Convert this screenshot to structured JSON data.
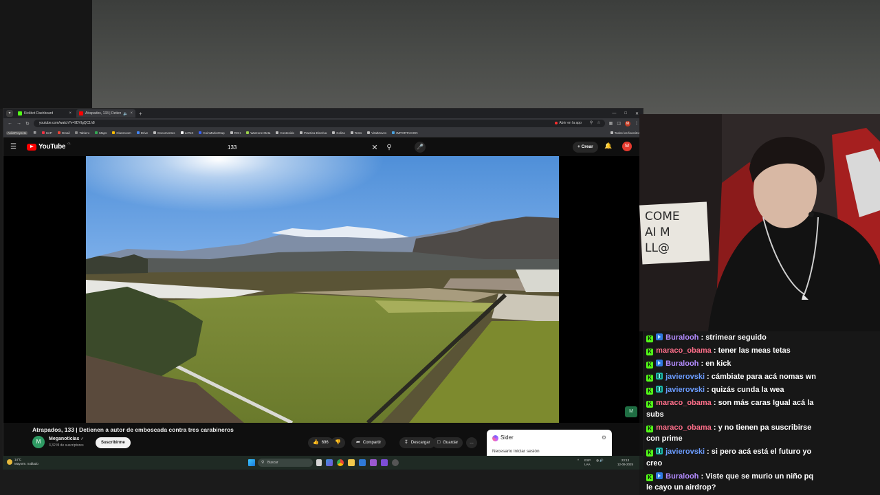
{
  "browser": {
    "tabs": [
      {
        "title": "Kickbot Dashboard",
        "active": false
      },
      {
        "title": "Atrapados, 133 | Detienen a",
        "active": true
      }
    ],
    "url": "youtube.com/watch?v=9DVlgQC1h8",
    "open_in_app": "Abrir en la app",
    "profile_initial": "M",
    "bookmarks": [
      "AvilaProyecto",
      "SAP",
      "Gmail",
      "Tablero",
      "Maps",
      "Classroom",
      "Drive",
      "Documentos",
      "LoToX",
      "CoinMarketCap",
      "RCH",
      "Warzone Meta",
      "Contenido",
      "Practica Electiva",
      "Coliza",
      "Tests",
      "VitalMoves",
      "IMPORTACION"
    ],
    "all_bookmarks": "Todos los favoritos"
  },
  "youtube": {
    "logo_text": "YouTube",
    "country": "CL",
    "search_query": "133",
    "create_label": "Crear",
    "avatar_initial": "M",
    "video_title": "Atrapados, 133 | Detienen a autor de emboscada contra tres carabineros",
    "channel_name": "Meganoticias",
    "channel_subs": "3,32 M de suscriptores",
    "subscribe_label": "Suscribirme",
    "likes": "696",
    "share_label": "Compartir",
    "download_label": "Descargar",
    "save_label": "Guardar",
    "more_label": "…"
  },
  "sider": {
    "title": "Sider",
    "message": "Necesario iniciar sesión"
  },
  "taskbar": {
    "temperature": "14°C",
    "weather_text": "Mayorm. nublado",
    "search_placeholder": "Buscar",
    "lang_1": "ESP",
    "lang_2": "LAA",
    "time": "23:13",
    "date": "12-09-2025"
  },
  "chat": {
    "messages": [
      {
        "user": "Buralooh",
        "text": "strimear seguido",
        "color": "#b38bff",
        "badges": [
          "kick",
          "blue"
        ]
      },
      {
        "user": "maraco_obama",
        "text": "tener las meas tetas",
        "color": "#ff6f8a",
        "badges": [
          "kick"
        ]
      },
      {
        "user": "Buralooh",
        "text": "en kick",
        "color": "#b38bff",
        "badges": [
          "kick",
          "blue"
        ]
      },
      {
        "user": "javierovski",
        "text": "cámbiate para acá nomas wn",
        "color": "#6b9cff",
        "badges": [
          "kick",
          "teal"
        ]
      },
      {
        "user": "javierovski",
        "text": "quizás cunda la wea",
        "color": "#6b9cff",
        "badges": [
          "kick",
          "teal"
        ]
      },
      {
        "user": "maraco_obama",
        "text": "son más caras Igual acá la subs",
        "color": "#ff6f8a",
        "badges": [
          "kick"
        ]
      },
      {
        "user": "maraco_obama",
        "text": "y no tienen pa suscribirse con prime",
        "color": "#ff6f8a",
        "badges": [
          "kick"
        ]
      },
      {
        "user": "javierovski",
        "text": "si pero acá está el futuro yo creo",
        "color": "#6b9cff",
        "badges": [
          "kick",
          "teal"
        ]
      },
      {
        "user": "Buralooh",
        "text": "Viste que se murio un niño pq le cayo un airdrop?",
        "color": "#b38bff",
        "badges": [
          "kick",
          "blue"
        ]
      }
    ]
  },
  "webcam": {
    "sign_lines": [
      "COME",
      "AI M",
      "LL@"
    ]
  }
}
